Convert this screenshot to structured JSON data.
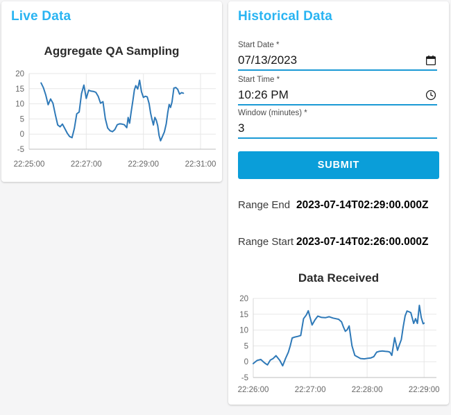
{
  "theme": {
    "heading_blue": "#29b4f2",
    "button_blue": "#0a9ed9",
    "underline_blue": "#1a99d5",
    "line_blue": "#2e79b8",
    "page_background": "#f5f5f6",
    "card_background": "#ffffff"
  },
  "live_panel": {
    "title": "Live Data"
  },
  "historical_panel": {
    "title": "Historical Data",
    "form": {
      "fields": [
        {
          "id": "start_date",
          "label": "Start Date *",
          "value": "07/13/2023",
          "icon": "calendar-icon"
        },
        {
          "id": "start_time",
          "label": "Start Time *",
          "value": "10:26 PM",
          "icon": "clock-icon"
        },
        {
          "id": "window_minutes",
          "label": "Window (minutes) *",
          "value": "3",
          "icon": null
        }
      ],
      "submit_label": "SUBMIT"
    },
    "results": [
      {
        "label": "Range End",
        "value": "2023-07-14T02:29:00.000Z"
      },
      {
        "label": "Range Start",
        "value": "2023-07-14T02:26:00.000Z"
      }
    ]
  },
  "chart_data": [
    {
      "id": "aggregate-qa-sampling",
      "type": "line",
      "title": "Aggregate QA Sampling",
      "grid": true,
      "legend": false,
      "x_axis": {
        "tick_labels": [
          "22:25:00",
          "22:27:00",
          "22:29:00",
          "22:31:00"
        ],
        "ticks_seconds": [
          0,
          120,
          240,
          360
        ],
        "range_seconds": [
          0,
          392
        ]
      },
      "y_axis": {
        "ticks": [
          20,
          15,
          10,
          5,
          0,
          -5
        ],
        "range": [
          -5,
          20
        ]
      },
      "series": [
        {
          "name": "Aggregate QA Sampling",
          "color": "#2e79b8",
          "points": [
            [
              25,
              16.9
            ],
            [
              30,
              15.3
            ],
            [
              35,
              12.9
            ],
            [
              40,
              9.7
            ],
            [
              45,
              11.6
            ],
            [
              50,
              10.2
            ],
            [
              55,
              6.5
            ],
            [
              60,
              3.0
            ],
            [
              65,
              2.4
            ],
            [
              70,
              3.3
            ],
            [
              75,
              1.8
            ],
            [
              80,
              0.3
            ],
            [
              85,
              -0.8
            ],
            [
              90,
              -1.2
            ],
            [
              95,
              1.9
            ],
            [
              100,
              6.7
            ],
            [
              105,
              7.3
            ],
            [
              110,
              13.4
            ],
            [
              115,
              16.2
            ],
            [
              120,
              11.8
            ],
            [
              125,
              14.5
            ],
            [
              130,
              14.2
            ],
            [
              135,
              14.1
            ],
            [
              140,
              13.8
            ],
            [
              145,
              12.5
            ],
            [
              150,
              10.2
            ],
            [
              155,
              10.7
            ],
            [
              160,
              5.1
            ],
            [
              165,
              2.0
            ],
            [
              170,
              1.1
            ],
            [
              175,
              0.8
            ],
            [
              180,
              1.5
            ],
            [
              185,
              3.1
            ],
            [
              190,
              3.4
            ],
            [
              195,
              3.3
            ],
            [
              200,
              3.1
            ],
            [
              205,
              2.1
            ],
            [
              208,
              5.5
            ],
            [
              211,
              3.6
            ],
            [
              214,
              7.1
            ],
            [
              218,
              11.2
            ],
            [
              221,
              14.6
            ],
            [
              224,
              16.0
            ],
            [
              228,
              14.9
            ],
            [
              232,
              17.8
            ],
            [
              236,
              14.0
            ],
            [
              240,
              12.1
            ],
            [
              244,
              12.5
            ],
            [
              248,
              12.3
            ],
            [
              252,
              10.1
            ],
            [
              255,
              7.0
            ],
            [
              258,
              4.9
            ],
            [
              261,
              3.0
            ],
            [
              264,
              5.5
            ],
            [
              267,
              4.6
            ],
            [
              270,
              2.8
            ],
            [
              273,
              -0.5
            ],
            [
              276,
              -2.2
            ],
            [
              280,
              -0.8
            ],
            [
              284,
              0.7
            ],
            [
              288,
              3.4
            ],
            [
              291,
              7.0
            ],
            [
              294,
              9.8
            ],
            [
              297,
              8.8
            ],
            [
              300,
              10.6
            ],
            [
              304,
              15.2
            ],
            [
              308,
              15.4
            ],
            [
              312,
              14.8
            ],
            [
              316,
              13.2
            ],
            [
              320,
              13.7
            ],
            [
              324,
              13.5
            ]
          ]
        }
      ]
    },
    {
      "id": "data-received",
      "type": "line",
      "title": "Data Received",
      "grid": true,
      "legend": false,
      "x_axis": {
        "tick_labels": [
          "22:26:00",
          "22:27:00",
          "22:28:00",
          "22:29:00"
        ],
        "ticks_seconds": [
          0,
          60,
          120,
          180
        ],
        "range_seconds": [
          0,
          193
        ]
      },
      "y_axis": {
        "ticks": [
          20,
          15,
          10,
          5,
          0,
          -5
        ],
        "range": [
          -5,
          20
        ]
      },
      "series": [
        {
          "name": "Data Received",
          "color": "#2e79b8",
          "points": [
            [
              0,
              -0.6
            ],
            [
              4,
              0.4
            ],
            [
              8,
              0.7
            ],
            [
              12,
              -0.4
            ],
            [
              15,
              -1.0
            ],
            [
              18,
              0.5
            ],
            [
              21,
              1.0
            ],
            [
              24,
              1.9
            ],
            [
              28,
              0.4
            ],
            [
              31,
              -1.3
            ],
            [
              34,
              1.0
            ],
            [
              37,
              3.0
            ],
            [
              39,
              5.0
            ],
            [
              41,
              7.5
            ],
            [
              44,
              7.8
            ],
            [
              47,
              8.0
            ],
            [
              50,
              8.3
            ],
            [
              53,
              13.6
            ],
            [
              56,
              14.8
            ],
            [
              58,
              16.1
            ],
            [
              62,
              11.6
            ],
            [
              65,
              13.2
            ],
            [
              68,
              14.4
            ],
            [
              72,
              14.0
            ],
            [
              76,
              13.9
            ],
            [
              80,
              14.2
            ],
            [
              84,
              13.8
            ],
            [
              87,
              13.6
            ],
            [
              90,
              13.4
            ],
            [
              93,
              12.6
            ],
            [
              95,
              11.0
            ],
            [
              97,
              9.6
            ],
            [
              99,
              10.1
            ],
            [
              101,
              11.3
            ],
            [
              104,
              5.0
            ],
            [
              107,
              2.0
            ],
            [
              110,
              1.5
            ],
            [
              113,
              1.0
            ],
            [
              117,
              0.9
            ],
            [
              121,
              1.1
            ],
            [
              124,
              1.2
            ],
            [
              127,
              1.6
            ],
            [
              130,
              3.0
            ],
            [
              133,
              3.3
            ],
            [
              136,
              3.4
            ],
            [
              139,
              3.3
            ],
            [
              142,
              3.2
            ],
            [
              144,
              3.0
            ],
            [
              146,
              2.0
            ],
            [
              149,
              7.6
            ],
            [
              152,
              3.6
            ],
            [
              154,
              5.4
            ],
            [
              156,
              7.0
            ],
            [
              158,
              11.0
            ],
            [
              160,
              14.5
            ],
            [
              162,
              16.0
            ],
            [
              164,
              15.8
            ],
            [
              166,
              15.5
            ],
            [
              169,
              12.1
            ],
            [
              171,
              13.6
            ],
            [
              173,
              12.1
            ],
            [
              175,
              17.8
            ],
            [
              177,
              14.0
            ],
            [
              179,
              12.0
            ],
            [
              180,
              12.2
            ]
          ]
        }
      ]
    }
  ]
}
